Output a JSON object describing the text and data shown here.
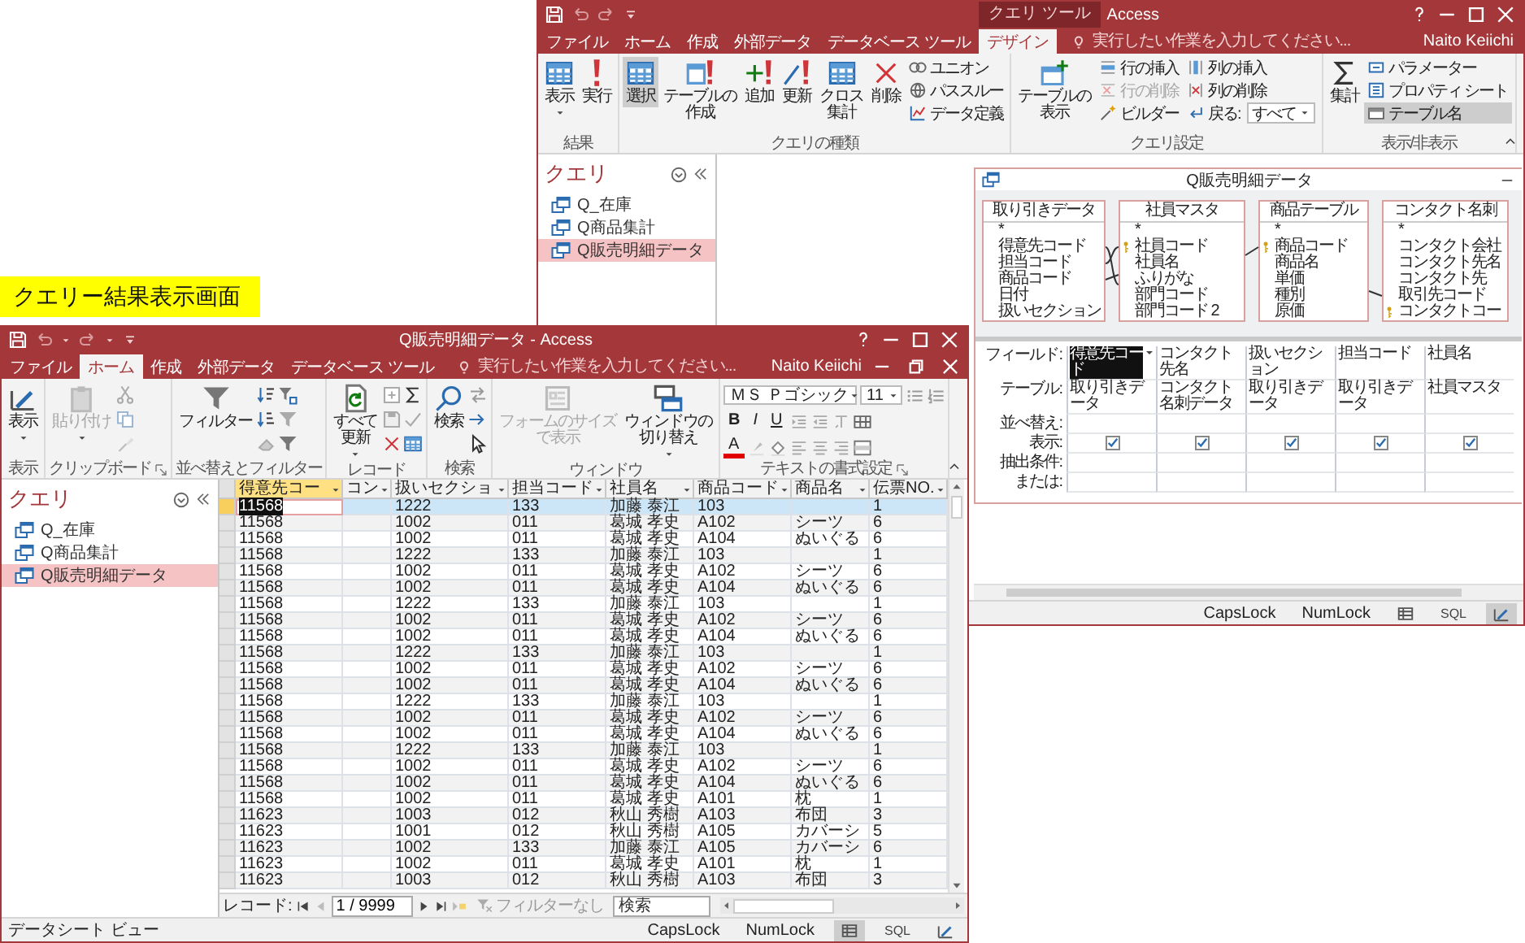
{
  "banner": {
    "text": "クエリー結果表示画面"
  },
  "back_window": {
    "title_context": "クエリ ツール",
    "title": "Access",
    "tabs": [
      {
        "label": "ファイル",
        "selected": false
      },
      {
        "label": "ホーム",
        "selected": false
      },
      {
        "label": "作成",
        "selected": false
      },
      {
        "label": "外部データ",
        "selected": false
      },
      {
        "label": "データベース ツール",
        "selected": false
      },
      {
        "label": "デザイン",
        "selected": true
      }
    ],
    "tell_me": "実行したい作業を入力してください...",
    "user": "Naito Keiichi",
    "ribbon_groups": [
      {
        "label": "結果",
        "items": [
          {
            "kind": "large",
            "lines": [
              "表示"
            ],
            "selected": false,
            "disabled": false,
            "dropdown": true
          },
          {
            "kind": "large",
            "lines": [
              "実行"
            ],
            "selected": false,
            "disabled": false,
            "dropdown": false
          }
        ]
      },
      {
        "label": "クエリの種類",
        "items": [
          {
            "kind": "large",
            "lines": [
              "選択"
            ],
            "selected": true,
            "disabled": false,
            "dropdown": false
          },
          {
            "kind": "large",
            "lines": [
              "テーブルの",
              "作成"
            ],
            "selected": false,
            "disabled": false,
            "dropdown": false
          },
          {
            "kind": "large",
            "lines": [
              "追加"
            ],
            "selected": false,
            "disabled": false,
            "dropdown": false
          },
          {
            "kind": "large",
            "lines": [
              "更新"
            ],
            "selected": false,
            "disabled": false,
            "dropdown": false
          },
          {
            "kind": "large",
            "lines": [
              "クロス",
              "集計"
            ],
            "selected": false,
            "disabled": false,
            "dropdown": false
          },
          {
            "kind": "large",
            "lines": [
              "削除"
            ],
            "selected": false,
            "disabled": false,
            "dropdown": false
          },
          {
            "kind": "stack",
            "items": [
              {
                "kind": "small",
                "label": "ユニオン",
                "selected": false,
                "disabled": false
              },
              {
                "kind": "small",
                "label": "パススルー",
                "selected": false,
                "disabled": false
              },
              {
                "kind": "small",
                "label": "データ定義",
                "selected": false,
                "disabled": false
              }
            ]
          }
        ]
      },
      {
        "label": "クエリ設定",
        "items": [
          {
            "kind": "large",
            "lines": [
              "テーブルの",
              "表示"
            ],
            "selected": false,
            "disabled": false,
            "dropdown": false
          },
          {
            "kind": "stack",
            "items": [
              {
                "kind": "small",
                "label": "行の挿入",
                "selected": false,
                "disabled": false
              },
              {
                "kind": "small",
                "label": "行の削除",
                "selected": false,
                "disabled": true
              },
              {
                "kind": "small",
                "label": "ビルダー",
                "selected": false,
                "disabled": false
              }
            ]
          },
          {
            "kind": "stack",
            "items": [
              {
                "kind": "small",
                "label": "列の挿入",
                "selected": false,
                "disabled": false
              },
              {
                "kind": "small",
                "label": "列の削除",
                "selected": false,
                "disabled": false
              },
              {
                "kind": "combo",
                "label": "戻る:",
                "value": "すべて"
              }
            ]
          }
        ]
      },
      {
        "label": "表示/非表示",
        "items": [
          {
            "kind": "large",
            "lines": [
              "集計"
            ],
            "selected": false,
            "disabled": false,
            "dropdown": false
          },
          {
            "kind": "stack",
            "items": [
              {
                "kind": "small",
                "label": "パラメーター",
                "selected": false,
                "disabled": false
              },
              {
                "kind": "small",
                "label": "プロパティ シート",
                "selected": false,
                "disabled": false
              },
              {
                "kind": "small",
                "label": "テーブル名",
                "selected": true,
                "disabled": false
              }
            ]
          }
        ]
      }
    ],
    "nav_pane": {
      "header": "クエリ",
      "items": [
        {
          "label": "Q_在庫",
          "selected": false
        },
        {
          "label": "Q商品集計",
          "selected": false
        },
        {
          "label": "Q販売明細データ",
          "selected": true
        }
      ]
    },
    "query_design": {
      "title": "Q販売明細データ",
      "tables": [
        {
          "name": "取り引きデータ",
          "fields": [
            {
              "name": "*",
              "key": false
            },
            {
              "name": "得意先コード",
              "key": false
            },
            {
              "name": "担当コード",
              "key": false
            },
            {
              "name": "商品コード",
              "key": false
            },
            {
              "name": "日付",
              "key": false
            },
            {
              "name": "扱いセクション",
              "key": false
            }
          ]
        },
        {
          "name": "社員マスタ",
          "fields": [
            {
              "name": "*",
              "key": false
            },
            {
              "name": "社員コード",
              "key": true
            },
            {
              "name": "社員名",
              "key": false
            },
            {
              "name": "ふりがな",
              "key": false
            },
            {
              "name": "部門コード",
              "key": false
            },
            {
              "name": "部門コード 2",
              "key": false
            }
          ]
        },
        {
          "name": "商品テーブル",
          "fields": [
            {
              "name": "*",
              "key": false
            },
            {
              "name": "商品コード",
              "key": true
            },
            {
              "name": "商品名",
              "key": false
            },
            {
              "name": "単価",
              "key": false
            },
            {
              "name": "種別",
              "key": false
            },
            {
              "name": "原価",
              "key": false
            }
          ]
        },
        {
          "name": "コンタクト名刺",
          "fields": [
            {
              "name": "*",
              "key": false
            },
            {
              "name": "コンタクト会社",
              "key": false
            },
            {
              "name": "コンタクト先名",
              "key": false
            },
            {
              "name": "コンタクト先",
              "key": false
            },
            {
              "name": "取引先コード",
              "key": false
            },
            {
              "name": "コンタクトコー",
              "key": true
            }
          ]
        }
      ],
      "grid": {
        "rows": [
          {
            "label": "フィールド:",
            "kind": "field"
          },
          {
            "label": "テーブル:",
            "kind": "table"
          },
          {
            "label": "並べ替え:",
            "kind": "sort"
          },
          {
            "label": "表示:",
            "kind": "show"
          },
          {
            "label": "抽出条件:",
            "kind": "criteria"
          },
          {
            "label": "または:",
            "kind": "or"
          }
        ],
        "columns": [
          {
            "field": "得意先コード",
            "table": "取り引きデータ",
            "show": true,
            "selected": true
          },
          {
            "field": "コンタクト先名",
            "table": "コンタクト名刺データ",
            "show": true,
            "selected": false
          },
          {
            "field": "扱いセクション",
            "table": "取り引きデータ",
            "show": true,
            "selected": false
          },
          {
            "field": "担当コード",
            "table": "取り引きデータ",
            "show": true,
            "selected": false
          },
          {
            "field": "社員名",
            "table": "社員マスタ",
            "show": true,
            "selected": false
          }
        ]
      }
    },
    "status_bar": {
      "indicators": [
        "CapsLock",
        "NumLock"
      ],
      "views": [
        {
          "kind": "datasheet",
          "selected": false
        },
        {
          "kind": "sql",
          "label": "SQL",
          "selected": false
        },
        {
          "kind": "design",
          "selected": true
        }
      ]
    }
  },
  "front_window": {
    "title": "Q販売明細データ - Access",
    "tabs": [
      {
        "label": "ファイル",
        "selected": false
      },
      {
        "label": "ホーム",
        "selected": true
      },
      {
        "label": "作成",
        "selected": false
      },
      {
        "label": "外部データ",
        "selected": false
      },
      {
        "label": "データベース ツール",
        "selected": false
      }
    ],
    "tell_me": "実行したい作業を入力してください...",
    "user": "Naito Keiichi",
    "ribbon_groups": [
      {
        "kind": "view",
        "label": "表示",
        "launcher": false,
        "items": [
          {
            "lines": [
              "表示"
            ],
            "disabled": false,
            "dropdown": true
          }
        ]
      },
      {
        "kind": "clipboard",
        "label": "クリップボード",
        "launcher": true,
        "items": [
          {
            "lines": [
              "貼り付け"
            ],
            "disabled": true,
            "dropdown": true
          }
        ]
      },
      {
        "kind": "sort_filter",
        "label": "並べ替えとフィルター",
        "launcher": false,
        "items": [
          {
            "lines": [
              "フィルター"
            ],
            "disabled": false,
            "dropdown": false
          }
        ]
      },
      {
        "kind": "records",
        "label": "レコード",
        "launcher": false,
        "items": [
          {
            "lines": [
              "すべて",
              "更新"
            ],
            "disabled": false,
            "dropdown": true
          }
        ]
      },
      {
        "kind": "find",
        "label": "検索",
        "launcher": false,
        "items": [
          {
            "lines": [
              "検索"
            ],
            "disabled": false,
            "dropdown": false
          }
        ]
      },
      {
        "kind": "window",
        "label": "ウィンドウ",
        "launcher": false,
        "items": [
          {
            "lines": [
              "フォームのサイズ",
              "で表示"
            ],
            "disabled": true,
            "dropdown": false
          },
          {
            "lines": [
              "ウィンドウの",
              "切り替え"
            ],
            "disabled": false,
            "dropdown": true
          }
        ]
      },
      {
        "kind": "text_format",
        "label": "テキストの書式設定",
        "launcher": true,
        "font": "ＭＳ Ｐゴシック",
        "size": "11",
        "styles": [
          "B",
          "I",
          "U"
        ],
        "font_color": "A"
      }
    ],
    "nav_pane": {
      "header": "クエリ",
      "items": [
        {
          "label": "Q_在庫",
          "selected": false
        },
        {
          "label": "Q商品集計",
          "selected": false
        },
        {
          "label": "Q販売明細データ",
          "selected": true
        }
      ]
    },
    "datasheet": {
      "columns": [
        {
          "label": "得意先コー",
          "selected": true
        },
        {
          "label": "コン",
          "selected": false
        },
        {
          "label": "扱いセクショ",
          "selected": false
        },
        {
          "label": "担当コード",
          "selected": false
        },
        {
          "label": "社員名",
          "selected": false
        },
        {
          "label": "商品コード",
          "selected": false
        },
        {
          "label": "商品名",
          "selected": false
        },
        {
          "label": "伝票NO.",
          "selected": false
        }
      ],
      "rows": [
        {
          "selected": true,
          "cells": [
            "11568",
            null,
            "1222",
            "133",
            "加藤 泰江",
            "103",
            null,
            "1"
          ]
        },
        {
          "selected": false,
          "cells": [
            "11568",
            null,
            "1002",
            "011",
            "葛城 孝史",
            "A102",
            "シーツ",
            "6"
          ]
        },
        {
          "selected": false,
          "cells": [
            "11568",
            null,
            "1002",
            "011",
            "葛城 孝史",
            "A104",
            "ぬいぐる",
            "6"
          ]
        },
        {
          "selected": false,
          "cells": [
            "11568",
            null,
            "1222",
            "133",
            "加藤 泰江",
            "103",
            null,
            "1"
          ]
        },
        {
          "selected": false,
          "cells": [
            "11568",
            null,
            "1002",
            "011",
            "葛城 孝史",
            "A102",
            "シーツ",
            "6"
          ]
        },
        {
          "selected": false,
          "cells": [
            "11568",
            null,
            "1002",
            "011",
            "葛城 孝史",
            "A104",
            "ぬいぐる",
            "6"
          ]
        },
        {
          "selected": false,
          "cells": [
            "11568",
            null,
            "1222",
            "133",
            "加藤 泰江",
            "103",
            null,
            "1"
          ]
        },
        {
          "selected": false,
          "cells": [
            "11568",
            null,
            "1002",
            "011",
            "葛城 孝史",
            "A102",
            "シーツ",
            "6"
          ]
        },
        {
          "selected": false,
          "cells": [
            "11568",
            null,
            "1002",
            "011",
            "葛城 孝史",
            "A104",
            "ぬいぐる",
            "6"
          ]
        },
        {
          "selected": false,
          "cells": [
            "11568",
            null,
            "1222",
            "133",
            "加藤 泰江",
            "103",
            null,
            "1"
          ]
        },
        {
          "selected": false,
          "cells": [
            "11568",
            null,
            "1002",
            "011",
            "葛城 孝史",
            "A102",
            "シーツ",
            "6"
          ]
        },
        {
          "selected": false,
          "cells": [
            "11568",
            null,
            "1002",
            "011",
            "葛城 孝史",
            "A104",
            "ぬいぐる",
            "6"
          ]
        },
        {
          "selected": false,
          "cells": [
            "11568",
            null,
            "1222",
            "133",
            "加藤 泰江",
            "103",
            null,
            "1"
          ]
        },
        {
          "selected": false,
          "cells": [
            "11568",
            null,
            "1002",
            "011",
            "葛城 孝史",
            "A102",
            "シーツ",
            "6"
          ]
        },
        {
          "selected": false,
          "cells": [
            "11568",
            null,
            "1002",
            "011",
            "葛城 孝史",
            "A104",
            "ぬいぐる",
            "6"
          ]
        },
        {
          "selected": false,
          "cells": [
            "11568",
            null,
            "1222",
            "133",
            "加藤 泰江",
            "103",
            null,
            "1"
          ]
        },
        {
          "selected": false,
          "cells": [
            "11568",
            null,
            "1002",
            "011",
            "葛城 孝史",
            "A102",
            "シーツ",
            "6"
          ]
        },
        {
          "selected": false,
          "cells": [
            "11568",
            null,
            "1002",
            "011",
            "葛城 孝史",
            "A104",
            "ぬいぐる",
            "6"
          ]
        },
        {
          "selected": false,
          "cells": [
            "11568",
            null,
            "1002",
            "011",
            "葛城 孝史",
            "A101",
            "枕",
            "1"
          ]
        },
        {
          "selected": false,
          "cells": [
            "11623",
            null,
            "1003",
            "012",
            "秋山 秀樹",
            "A103",
            "布団",
            "3"
          ]
        },
        {
          "selected": false,
          "cells": [
            "11623",
            null,
            "1001",
            "012",
            "秋山 秀樹",
            "A105",
            "カバーシ",
            "5"
          ]
        },
        {
          "selected": false,
          "cells": [
            "11623",
            null,
            "1002",
            "133",
            "加藤 泰江",
            "A105",
            "カバーシ",
            "6"
          ]
        },
        {
          "selected": false,
          "cells": [
            "11623",
            null,
            "1002",
            "011",
            "葛城 孝史",
            "A101",
            "枕",
            "1"
          ]
        },
        {
          "selected": false,
          "cells": [
            "11623",
            null,
            "1003",
            "012",
            "秋山 秀樹",
            "A103",
            "布団",
            "3"
          ]
        }
      ]
    },
    "record_nav": {
      "label": "レコード:",
      "position": "1 / 9999",
      "filter": "フィルターなし",
      "search_placeholder": "検索"
    },
    "status_bar": {
      "text": "データシート ビュー",
      "indicators": [
        "CapsLock",
        "NumLock"
      ],
      "views": [
        {
          "kind": "datasheet",
          "selected": true
        },
        {
          "kind": "sql",
          "label": "SQL",
          "selected": false
        },
        {
          "kind": "design",
          "selected": false
        }
      ]
    }
  }
}
